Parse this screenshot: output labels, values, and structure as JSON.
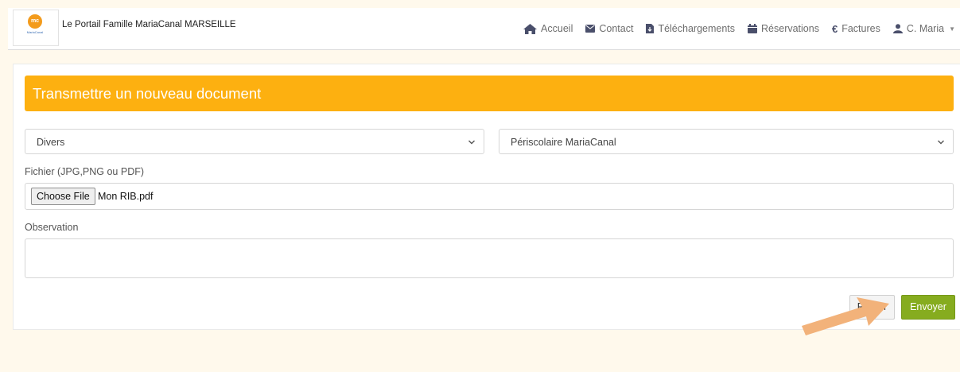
{
  "header": {
    "logo_mark": "mc",
    "logo_caption": "MariaCanal",
    "title": "Le Portail Famille MariaCanal MARSEILLE"
  },
  "nav": {
    "items": [
      {
        "label": "Accueil",
        "icon": "home-icon"
      },
      {
        "label": "Contact",
        "icon": "envelope-icon"
      },
      {
        "label": "Téléchargements",
        "icon": "file-download-icon"
      },
      {
        "label": "Réservations",
        "icon": "calendar-icon"
      },
      {
        "label": "Factures",
        "icon": "euro-icon"
      }
    ],
    "user": {
      "label": "C. Maria",
      "icon": "user-icon"
    }
  },
  "form": {
    "title": "Transmettre un nouveau document",
    "category_select": {
      "value": "Divers"
    },
    "service_select": {
      "value": "Périscolaire MariaCanal"
    },
    "file_label": "Fichier (JPG,PNG ou PDF)",
    "file_button": "Choose File",
    "file_name": "Mon RIB.pdf",
    "observation_label": "Observation",
    "observation_value": "",
    "retour_label": "Retour",
    "envoyer_label": "Envoyer"
  },
  "colors": {
    "accent_header": "#fdb010",
    "envoyer_button": "#86ac1f",
    "pointer_arrow": "#f2b27a",
    "page_background": "#fff9ec"
  }
}
